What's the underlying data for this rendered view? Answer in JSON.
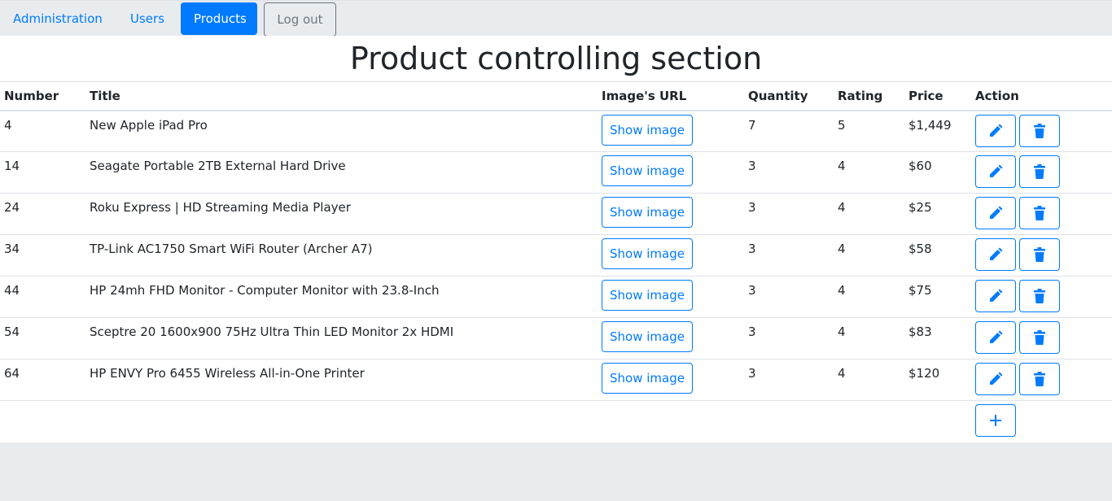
{
  "nav": {
    "items": [
      {
        "label": "Administration",
        "active": false
      },
      {
        "label": "Users",
        "active": false
      },
      {
        "label": "Products",
        "active": true
      }
    ],
    "logout_label": "Log out"
  },
  "page": {
    "title": "Product controlling section"
  },
  "table": {
    "columns": [
      "Number",
      "Title",
      "Image's URL",
      "Quantity",
      "Rating",
      "Price",
      "Action"
    ],
    "show_image_label": "Show image",
    "rows": [
      {
        "number": "4",
        "title": "New Apple iPad Pro",
        "quantity": "7",
        "rating": "5",
        "price": "$1,449"
      },
      {
        "number": "14",
        "title": "Seagate Portable 2TB External Hard Drive",
        "quantity": "3",
        "rating": "4",
        "price": "$60"
      },
      {
        "number": "24",
        "title": "Roku Express | HD Streaming Media Player",
        "quantity": "3",
        "rating": "4",
        "price": "$25"
      },
      {
        "number": "34",
        "title": "TP-Link AC1750 Smart WiFi Router (Archer A7)",
        "quantity": "3",
        "rating": "4",
        "price": "$58"
      },
      {
        "number": "44",
        "title": "HP 24mh FHD Monitor - Computer Monitor with 23.8-Inch",
        "quantity": "3",
        "rating": "4",
        "price": "$75"
      },
      {
        "number": "54",
        "title": "Sceptre 20 1600x900 75Hz Ultra Thin LED Monitor 2x HDMI",
        "quantity": "3",
        "rating": "4",
        "price": "$83"
      },
      {
        "number": "64",
        "title": "HP ENVY Pro 6455 Wireless All-in-One Printer",
        "quantity": "3",
        "rating": "4",
        "price": "$120"
      }
    ]
  },
  "icons": {
    "edit": "pencil-icon",
    "delete": "trash-icon",
    "add": "plus-icon"
  },
  "colors": {
    "primary": "#007bff",
    "secondary": "#6c757d",
    "background": "#e9ecef"
  }
}
